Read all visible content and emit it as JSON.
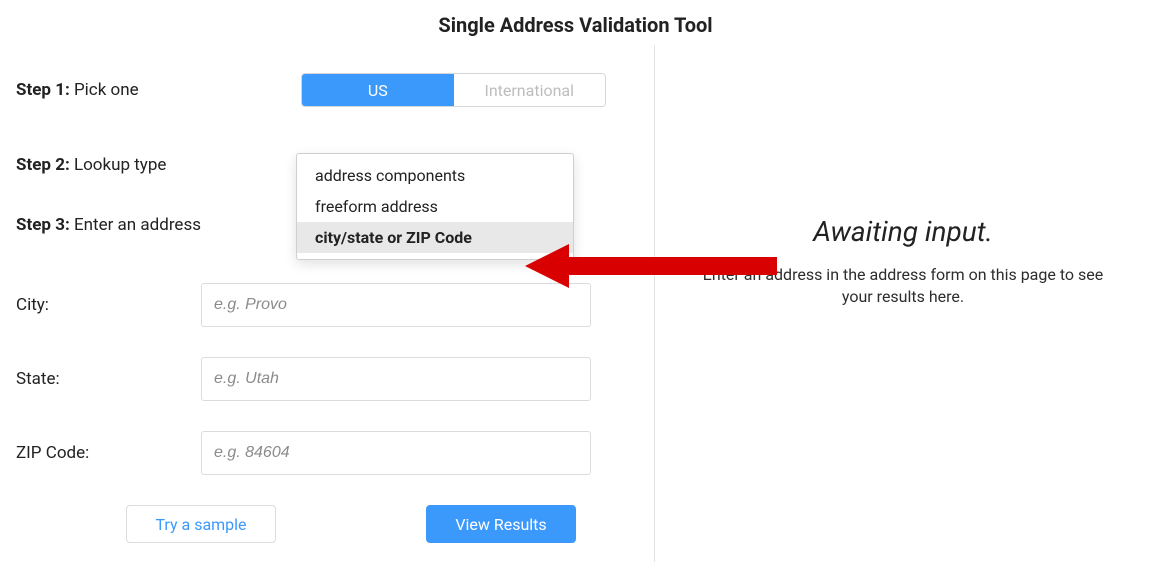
{
  "title": "Single Address Validation Tool",
  "steps": {
    "step1": {
      "label": "Step 1:",
      "text": "Pick one"
    },
    "step2": {
      "label": "Step 2:",
      "text": "Lookup type"
    },
    "step3": {
      "label": "Step 3:",
      "text": "Enter an address"
    }
  },
  "toggle": {
    "us": "US",
    "intl": "International"
  },
  "dropdown": {
    "opt1": "address components",
    "opt2": "freeform address",
    "opt3": "city/state or ZIP Code"
  },
  "fields": {
    "city": {
      "label": "City:",
      "placeholder": "e.g. Provo"
    },
    "state": {
      "label": "State:",
      "placeholder": "e.g. Utah"
    },
    "zip": {
      "label": "ZIP Code:",
      "placeholder": "e.g. 84604"
    }
  },
  "buttons": {
    "sample": "Try a sample",
    "view": "View Results"
  },
  "results": {
    "heading": "Awaiting input.",
    "sub": "Enter an address in the address form on this page to see your results here."
  },
  "colors": {
    "accent": "#3b99fc",
    "arrow": "#d80000"
  }
}
